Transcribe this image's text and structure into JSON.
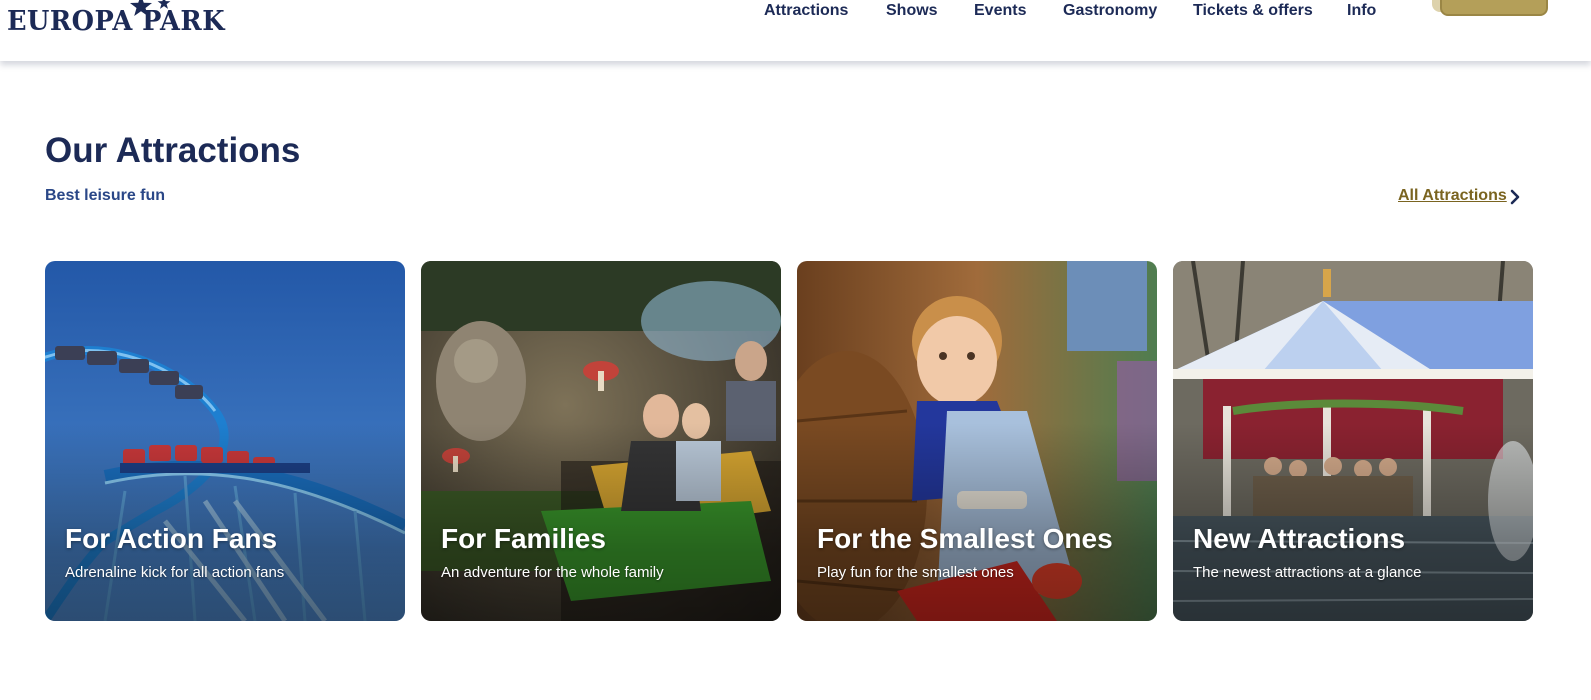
{
  "brand": {
    "logo_text": "EUROPA PARK",
    "logo_color": "#1c2a56"
  },
  "nav": {
    "items": [
      {
        "label": "Attractions"
      },
      {
        "label": "Shows"
      },
      {
        "label": "Events"
      },
      {
        "label": "Gastronomy"
      },
      {
        "label": "Tickets & offers"
      },
      {
        "label": "Info"
      }
    ]
  },
  "section": {
    "title": "Our Attractions",
    "subtitle": "Best leisure fun",
    "all_link": "All Attractions"
  },
  "cards": [
    {
      "title": "For Action Fans",
      "desc": "Adrenaline kick for all action fans"
    },
    {
      "title": "For Families",
      "desc": "An adventure for the whole family"
    },
    {
      "title": "For the Smallest Ones",
      "desc": "Play fun for the smallest ones"
    },
    {
      "title": "New Attractions",
      "desc": "The newest attractions at a glance"
    }
  ],
  "colors": {
    "navy": "#1c2a56",
    "link_gold": "#7a6420",
    "ticket_gold": "#b49f59"
  }
}
